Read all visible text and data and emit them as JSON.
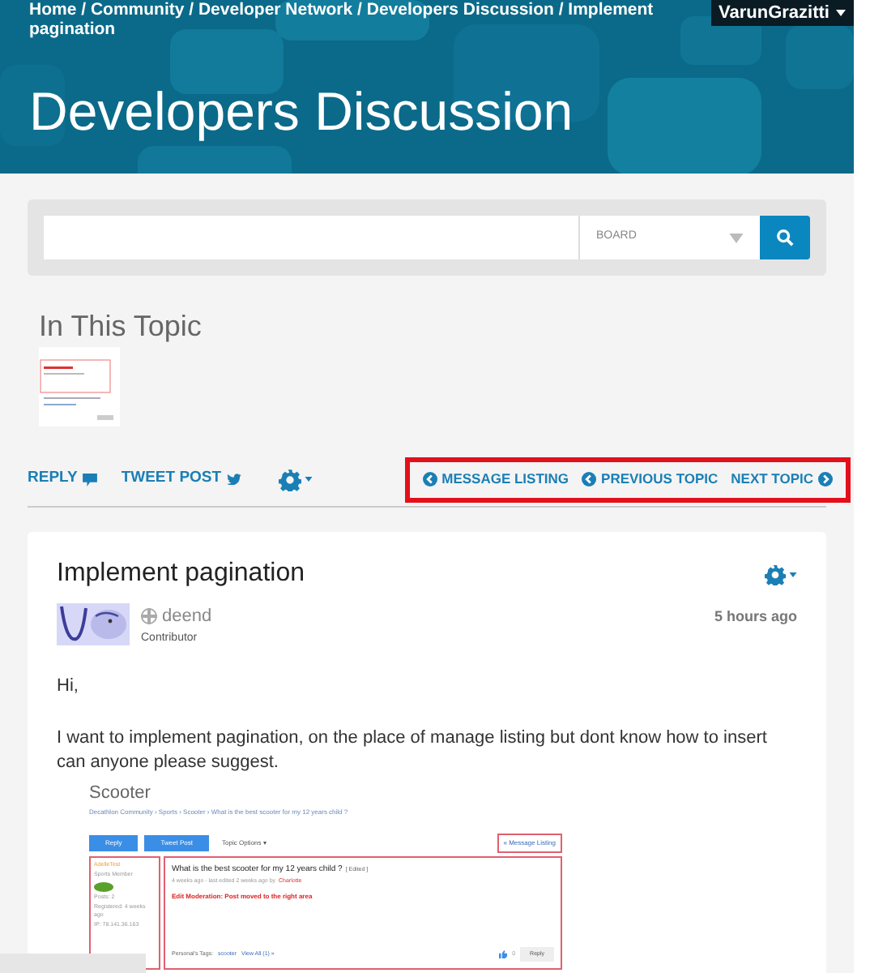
{
  "breadcrumbs": [
    "Home",
    "Community",
    "Developer Network",
    "Developers Discussion",
    "Implement pagination"
  ],
  "user_menu": {
    "label": "VarunGrazitti"
  },
  "page_title": "Developers Discussion",
  "search": {
    "scope": "BOARD"
  },
  "in_this_topic": {
    "title": "In This Topic"
  },
  "breadcrumb_separator": "/",
  "actions": [
    {
      "label": "REPLY"
    },
    {
      "label": "TWEET POST"
    }
  ],
  "navigation": [
    {
      "label": "MESSAGE LISTING",
      "kind": "back"
    },
    {
      "label": "PREVIOUS TOPIC",
      "kind": "back"
    },
    {
      "label": "NEXT TOPIC",
      "kind": "forward"
    }
  ],
  "post": {
    "title": "Implement pagination",
    "author": "deend",
    "rank": "Contributor",
    "time": "5 hours ago",
    "body": [
      "Hi,",
      "I want to implement pagination, on the place of manage listing but dont know how to insert can anyone please suggest."
    ],
    "embedded_screenshot": {
      "title": "Scooter",
      "breadcrumb": "Decathlon Community  ›  Sports  ›  Scooter  ›  What is the best scooter for my 12 years child ?",
      "buttons": [
        "Reply",
        "Tweet Post"
      ],
      "options": "Topic Options ▾",
      "listing_link": "« Message Listing",
      "sidebar": [
        "AdelleTest",
        "Sports Member",
        "Posts: 2",
        "Registered: 4 weeks ago",
        "IP: 78.141.36.163"
      ],
      "message_title": "What is the best scooter for my 12 years child ?",
      "edited": "[ Edited ]",
      "meta": "4 weeks ago - last edited 2 weeks ago by",
      "editor": "Charlotte",
      "moderation": "Edit Moderation: Post moved to the right area",
      "tags_label": "Personal's Tags:",
      "tag": "scooter",
      "view_all": "View All (1) »",
      "kudos": "0",
      "reply": "Reply"
    }
  }
}
